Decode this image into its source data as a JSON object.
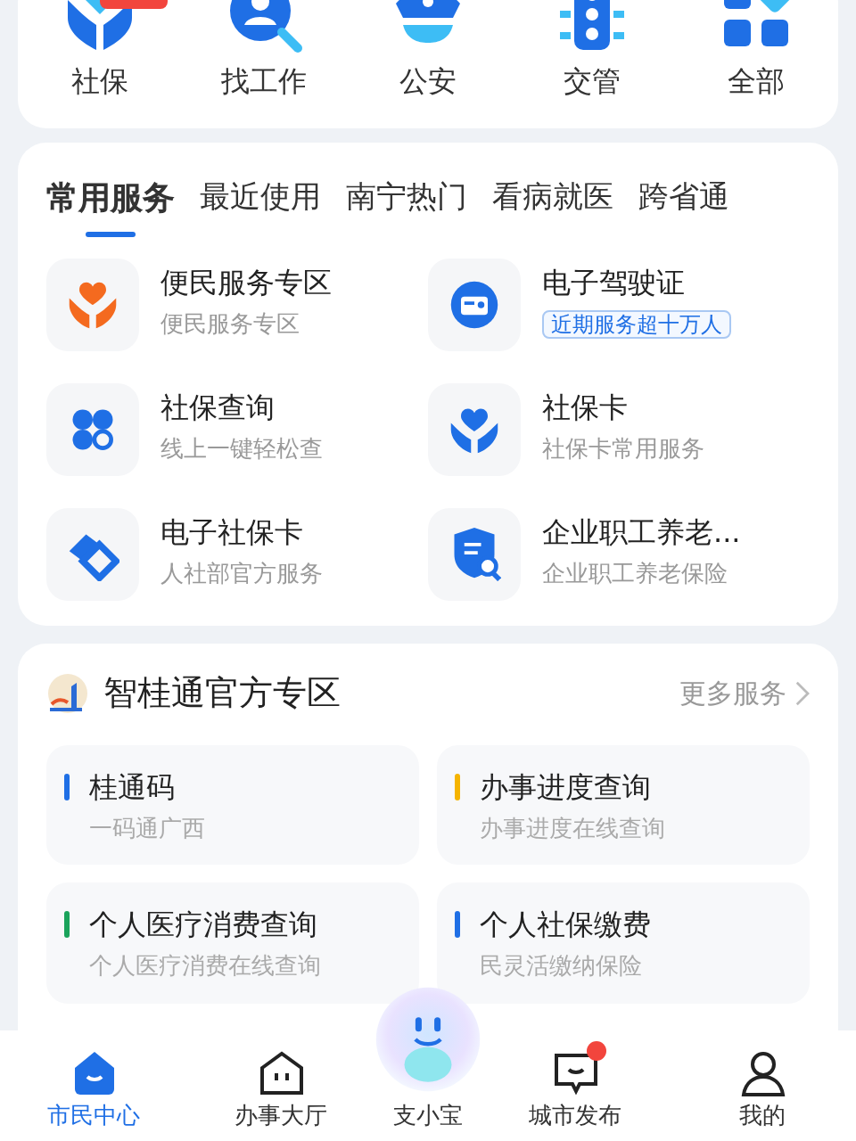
{
  "top_services": [
    {
      "label": "社保",
      "badge": true
    },
    {
      "label": "找工作",
      "badge": false
    },
    {
      "label": "公安",
      "badge": false
    },
    {
      "label": "交管",
      "badge": false
    },
    {
      "label": "全部",
      "badge": false
    }
  ],
  "tabs": [
    {
      "label": "常用服务",
      "selected": true
    },
    {
      "label": "最近使用",
      "selected": false
    },
    {
      "label": "南宁热门",
      "selected": false
    },
    {
      "label": "看病就医",
      "selected": false
    },
    {
      "label": "跨省通",
      "selected": false
    }
  ],
  "services": [
    {
      "title": "便民服务专区",
      "subtitle": "便民服务专区",
      "kind": "plain"
    },
    {
      "title": "电子驾驶证",
      "subtitle": "近期服务超十万人",
      "kind": "tag"
    },
    {
      "title": "社保查询",
      "subtitle": "线上一键轻松查",
      "kind": "plain"
    },
    {
      "title": "社保卡",
      "subtitle": "社保卡常用服务",
      "kind": "plain"
    },
    {
      "title": "电子社保卡",
      "subtitle": "人社部官方服务",
      "kind": "plain"
    },
    {
      "title": "企业职工养老...",
      "subtitle": "企业职工养老保险",
      "kind": "plain"
    }
  ],
  "zone": {
    "title": "智桂通官方专区",
    "more": "更多服务",
    "tiles": [
      {
        "title": "桂通码",
        "subtitle": "一码通广西",
        "color": "#1f6fe5"
      },
      {
        "title": "办事进度查询",
        "subtitle": "办事进度在线查询",
        "color": "#f5b400"
      },
      {
        "title": "个人医疗消费查询",
        "subtitle": "个人医疗消费在线查询",
        "color": "#1aa35b"
      },
      {
        "title": "个人社保缴费",
        "subtitle": "民灵活缴纳保险",
        "color": "#1f6fe5"
      }
    ]
  },
  "nav": [
    {
      "label": "市民中心",
      "selected": true,
      "dot": false
    },
    {
      "label": "办事大厅",
      "selected": false,
      "dot": false
    },
    {
      "label": "支小宝",
      "selected": false,
      "dot": false
    },
    {
      "label": "城市发布",
      "selected": false,
      "dot": true
    },
    {
      "label": "我的",
      "selected": false,
      "dot": false
    }
  ]
}
